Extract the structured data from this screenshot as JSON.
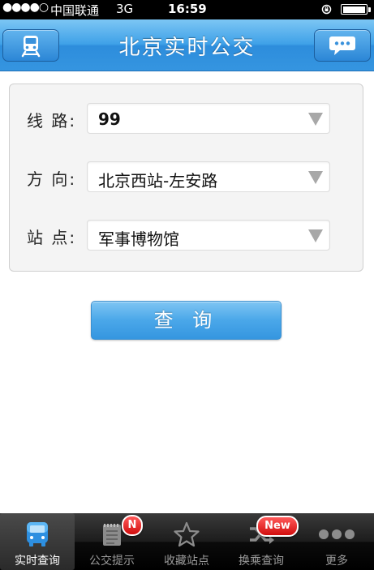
{
  "status_bar": {
    "signal": "●●●●○",
    "carrier": "中国联通",
    "network": "3G",
    "time": "16:59"
  },
  "header": {
    "title": "北京实时公交",
    "left_icon": "train-icon",
    "right_icon": "chat-bubble-icon"
  },
  "form": {
    "route": {
      "label": "线 路:",
      "value": "99"
    },
    "direction": {
      "label": "方 向:",
      "value": "北京西站-左安路"
    },
    "station": {
      "label": "站 点:",
      "value": "军事博物馆"
    }
  },
  "query_button": {
    "label": "查 询"
  },
  "tab_bar": {
    "tabs": [
      {
        "label": "实时查询",
        "icon": "bus-icon",
        "active": true
      },
      {
        "label": "公交提示",
        "icon": "notepad-icon",
        "badge": "N"
      },
      {
        "label": "收藏站点",
        "icon": "star-icon"
      },
      {
        "label": "换乘查询",
        "icon": "shuffle-icon",
        "badge": "New"
      },
      {
        "label": "更多",
        "icon": "more-dots-icon"
      }
    ]
  },
  "colors": {
    "header_blue": "#3fa1e8",
    "badge_red": "#d10d0d",
    "tab_active_text": "#ffffff",
    "tab_inactive_text": "#9a9a9a"
  }
}
